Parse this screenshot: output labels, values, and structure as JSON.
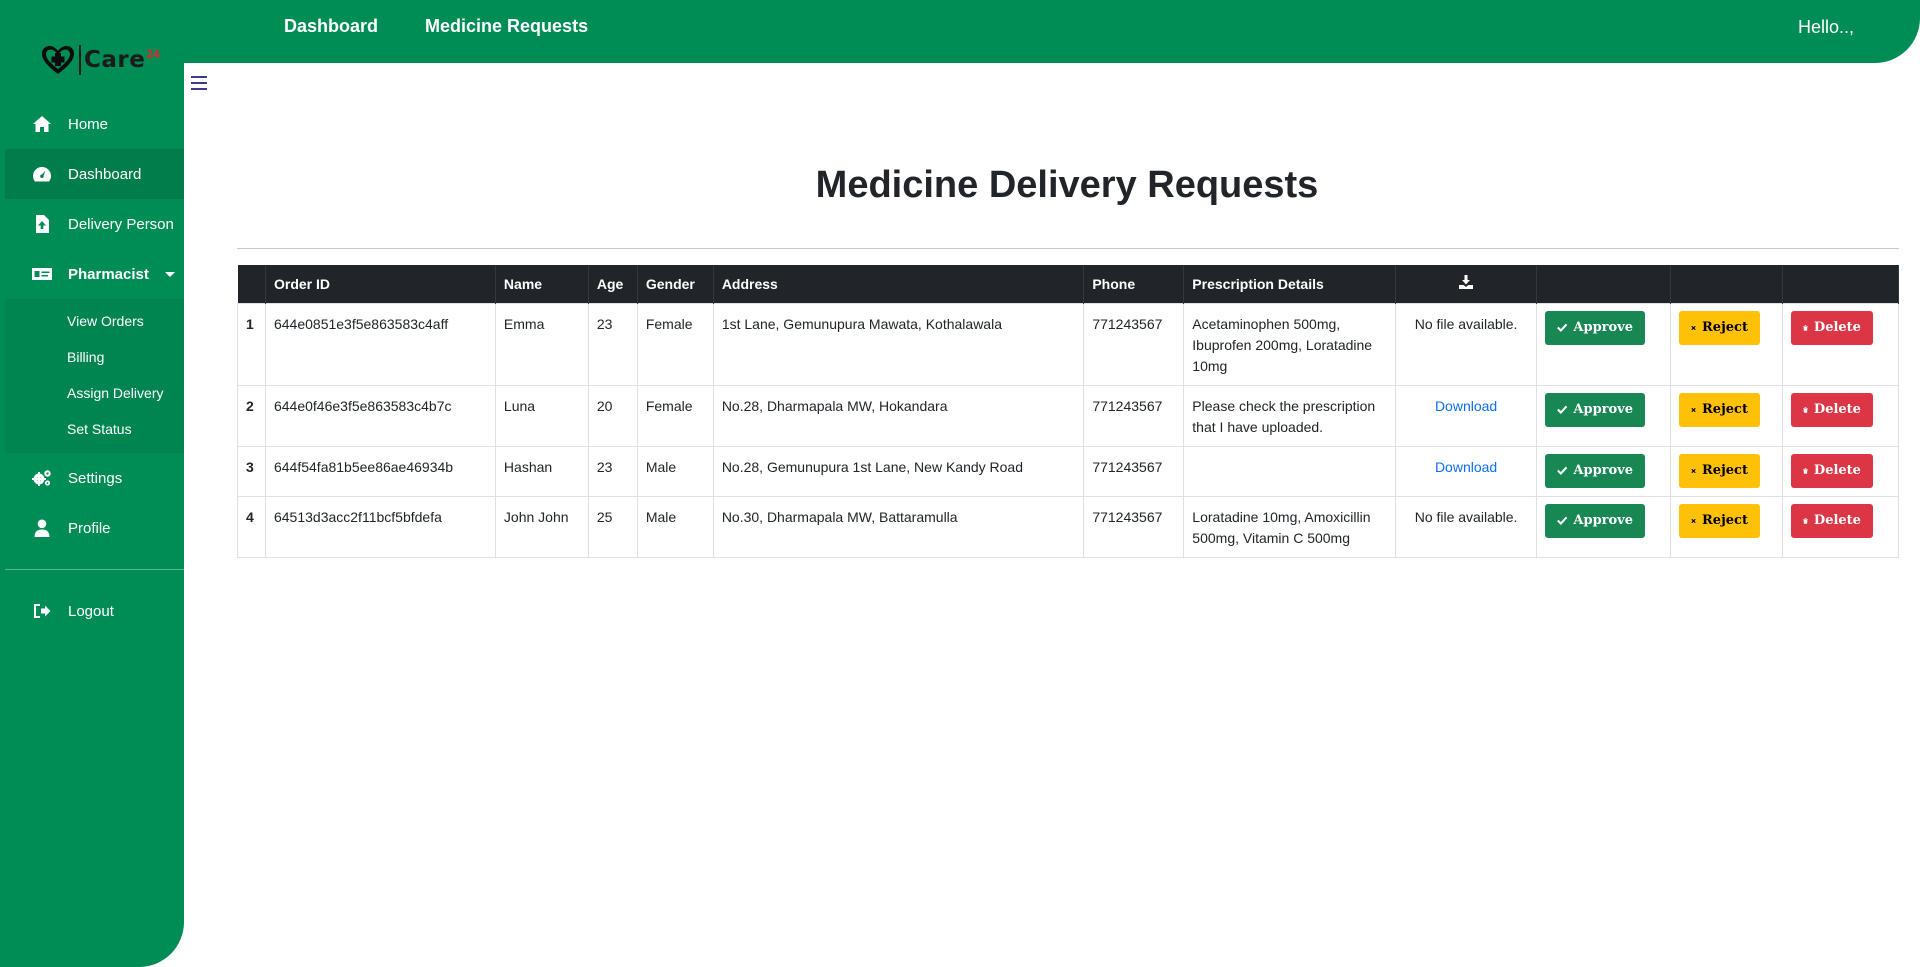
{
  "header": {
    "nav": [
      "Dashboard",
      "Medicine Requests"
    ],
    "greeting": "Hello..,"
  },
  "logo": {
    "text": "Care",
    "sup": "24"
  },
  "sidebar": {
    "items": [
      {
        "label": "Home",
        "icon": "home-icon"
      },
      {
        "label": "Dashboard",
        "icon": "dashboard-gauge-icon"
      },
      {
        "label": "Delivery Person",
        "icon": "file-upload-icon"
      },
      {
        "label": "Pharmacist",
        "icon": "id-card-icon"
      }
    ],
    "pharmacist_sub": [
      "View Orders",
      "Billing",
      "Assign Delivery",
      "Set Status"
    ],
    "settings": "Settings",
    "profile": "Profile",
    "logout": "Logout"
  },
  "main": {
    "title": "Medicine Delivery Requests",
    "columns": [
      "",
      "Order ID",
      "Name",
      "Age",
      "Gender",
      "Address",
      "Phone",
      "Prescription Details"
    ],
    "buttons": {
      "approve": "Approve",
      "reject": "Reject",
      "delete": "Delete"
    },
    "rows": [
      {
        "idx": "1",
        "order_id": "644e0851e3f5e863583c4aff",
        "name": "Emma",
        "age": "23",
        "gender": "Female",
        "address": "1st Lane, Gemunupura Mawata, Kothalawala",
        "phone": "771243567",
        "prescription": "Acetaminophen 500mg, Ibuprofen 200mg, Loratadine 10mg",
        "file": "No file available.",
        "file_is_link": false
      },
      {
        "idx": "2",
        "order_id": "644e0f46e3f5e863583c4b7c",
        "name": "Luna",
        "age": "20",
        "gender": "Female",
        "address": "No.28, Dharmapala MW, Hokandara",
        "phone": "771243567",
        "prescription": "Please check the prescription that I have uploaded.",
        "file": "Download",
        "file_is_link": true
      },
      {
        "idx": "3",
        "order_id": "644f54fa81b5ee86ae46934b",
        "name": "Hashan",
        "age": "23",
        "gender": "Male",
        "address": "No.28, Gemunupura 1st Lane, New Kandy Road",
        "phone": "771243567",
        "prescription": "",
        "file": "Download",
        "file_is_link": true
      },
      {
        "idx": "4",
        "order_id": "64513d3acc2f11bcf5bfdefa",
        "name": "John John",
        "age": "25",
        "gender": "Male",
        "address": "No.30, Dharmapala MW, Battaramulla",
        "phone": "771243567",
        "prescription": "Loratadine 10mg, Amoxicillin 500mg, Vitamin C 500mg",
        "file": "No file available.",
        "file_is_link": false
      }
    ]
  },
  "colors": {
    "brand_green": "#008c55",
    "approve": "#198754",
    "reject": "#ffc107",
    "delete": "#dc3545",
    "table_head": "#212529"
  }
}
